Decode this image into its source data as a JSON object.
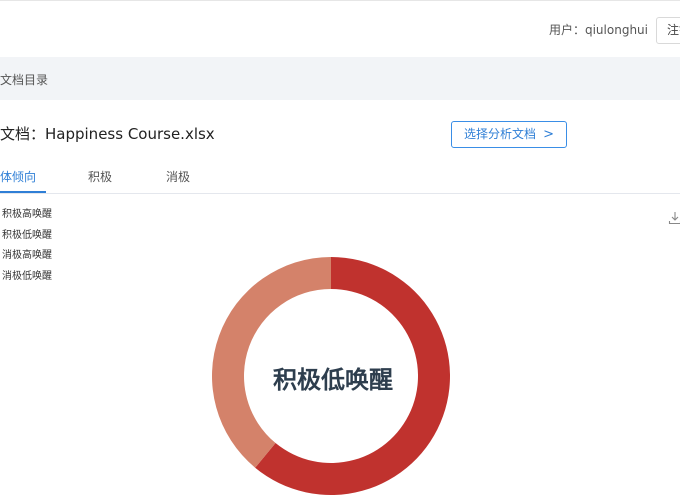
{
  "header": {
    "user_label": "用户：qiulonghui",
    "button_label": "注销"
  },
  "breadcrumb": {
    "label": "文档目录"
  },
  "document": {
    "title": "文档：Happiness Course.xlsx",
    "select_button": "选择分析文档",
    "select_button_icon": "chevron-right-icon"
  },
  "tabs": [
    {
      "label": "总体倾向",
      "visible_label": "体倾向",
      "active": true
    },
    {
      "label": "积极",
      "active": false
    },
    {
      "label": "消极",
      "active": false
    }
  ],
  "toolbar": {
    "download_icon": "download-icon"
  },
  "chart_data": {
    "type": "pie",
    "variant": "donut",
    "title": "",
    "center_label": "积极低唤醒",
    "legend": [
      "积极高唤醒",
      "积极低唤醒",
      "消极高唤醒",
      "消极低唤醒"
    ],
    "legend_position": "top-left",
    "slices": [
      {
        "name": "积极低唤醒",
        "value": 61,
        "color": "#c0322e"
      },
      {
        "name": "消极低唤醒",
        "value": 39,
        "color": "#d4826a"
      }
    ]
  },
  "colors": {
    "accent": "#2f7fd6",
    "crumb_bg": "#f2f4f7"
  }
}
